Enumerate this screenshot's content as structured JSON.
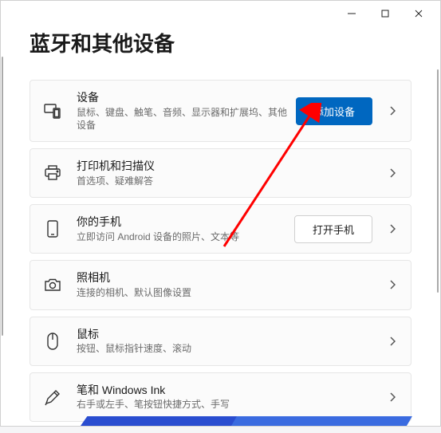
{
  "header": {
    "title": "蓝牙和其他设备"
  },
  "cards": {
    "devices": {
      "title": "设备",
      "sub": "鼠标、键盘、触笔、音频、显示器和扩展坞、其他设备",
      "button": "添加设备"
    },
    "printers": {
      "title": "打印机和扫描仪",
      "sub": "首选项、疑难解答"
    },
    "phone": {
      "title": "你的手机",
      "sub": "立即访问 Android 设备的照片、文本等",
      "button": "打开手机"
    },
    "camera": {
      "title": "照相机",
      "sub": "连接的相机、默认图像设置"
    },
    "mouse": {
      "title": "鼠标",
      "sub": "按钮、鼠标指针速度、滚动"
    },
    "pen": {
      "title": "笔和 Windows Ink",
      "sub": "右手或左手、笔按钮快捷方式、手写"
    }
  }
}
